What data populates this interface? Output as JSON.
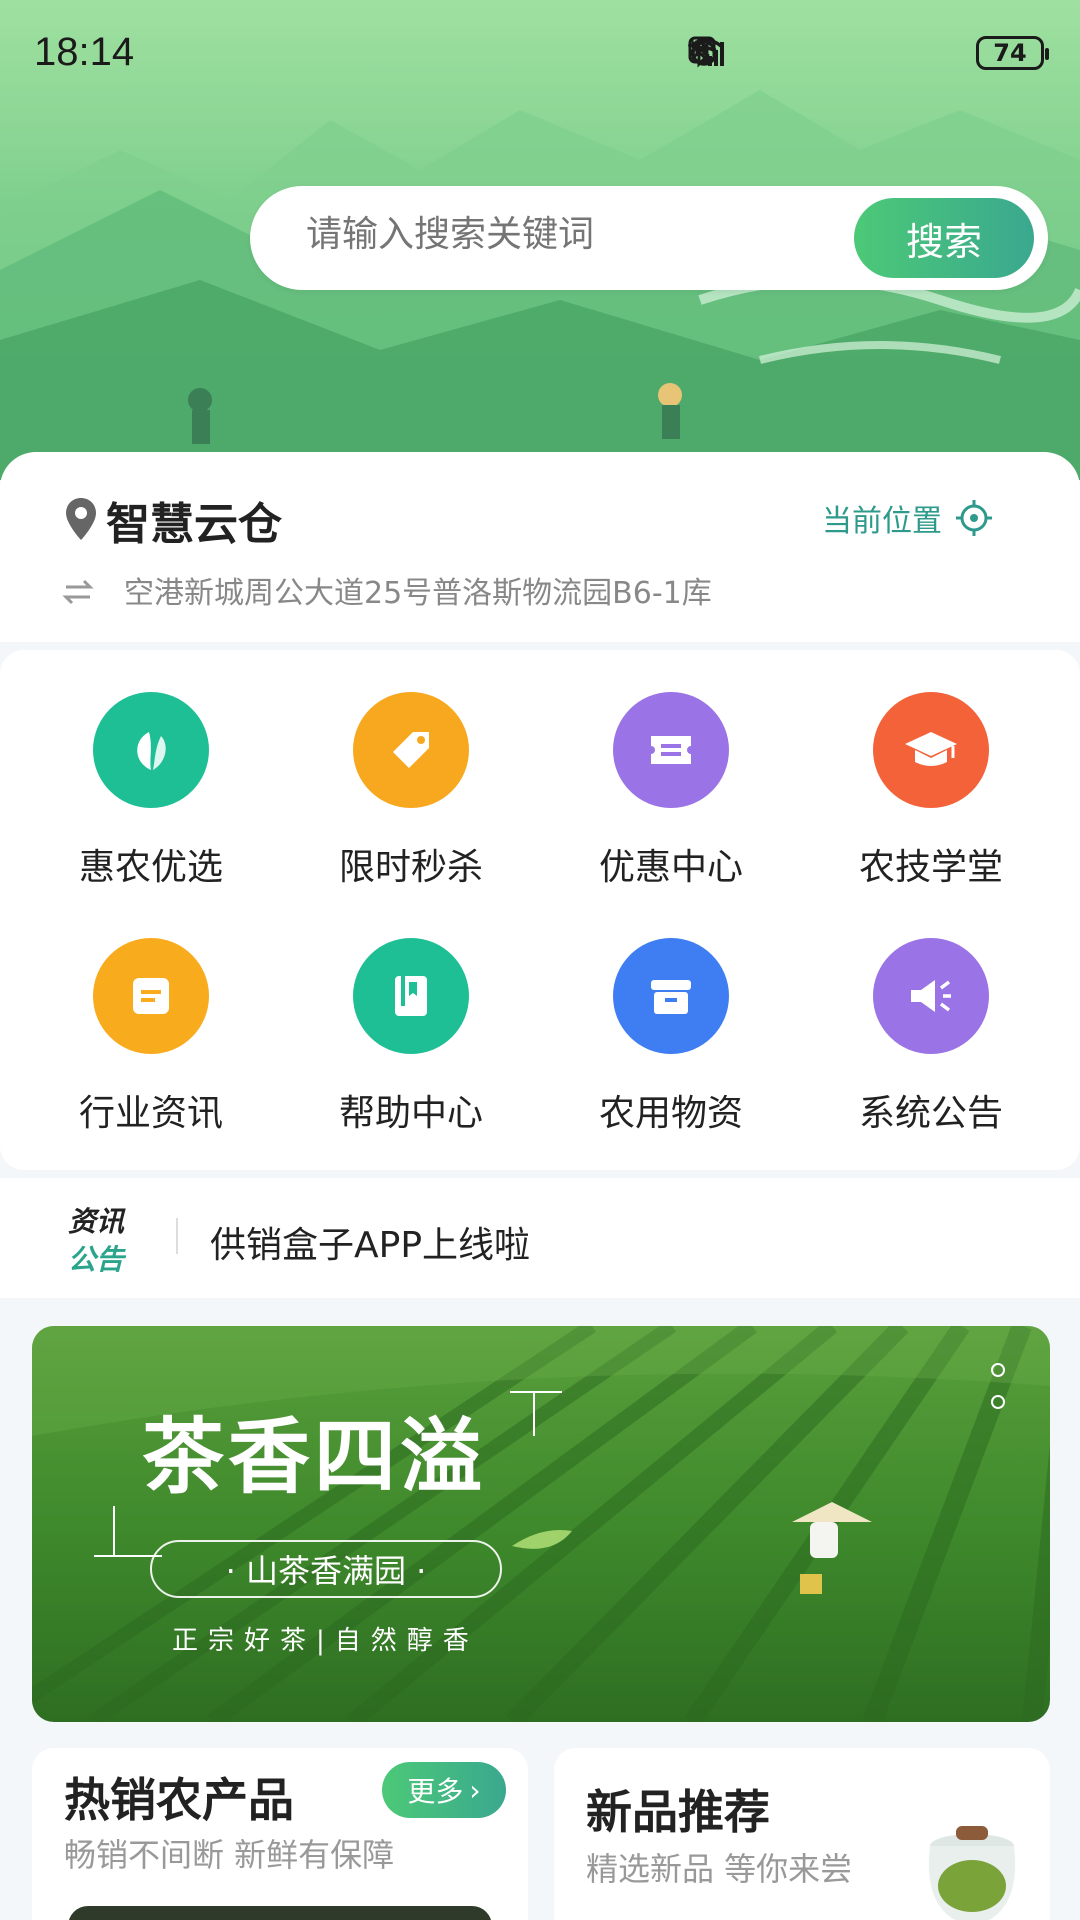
{
  "status_bar": {
    "time": "18:14",
    "icons": [
      "nfc-icon",
      "alarm-icon",
      "bluetooth-icon",
      "wifi-icon",
      "signal-4g-icon",
      "signal-4g-icon"
    ],
    "battery": "74"
  },
  "search": {
    "placeholder": "请输入搜索关键词",
    "button_label": "搜索"
  },
  "location": {
    "name": "智慧云仓",
    "current_label": "当前位置",
    "address": "空港新城周公大道25号普洛斯物流园B6-1库"
  },
  "grid": [
    {
      "label": "惠农优选",
      "icon": "leaf-icon",
      "color": "#1fbf95"
    },
    {
      "label": "限时秒杀",
      "icon": "tag-icon",
      "color": "#f8a81f"
    },
    {
      "label": "优惠中心",
      "icon": "coupon-icon",
      "color": "#9a74e6"
    },
    {
      "label": "农技学堂",
      "icon": "graduation-cap-icon",
      "color": "#f4623a"
    },
    {
      "label": "行业资讯",
      "icon": "note-icon",
      "color": "#f9ab1e"
    },
    {
      "label": "帮助中心",
      "icon": "book-icon",
      "color": "#1fbf95"
    },
    {
      "label": "农用物资",
      "icon": "box-icon",
      "color": "#3f7ef2"
    },
    {
      "label": "系统公告",
      "icon": "speaker-icon",
      "color": "#9a74e6"
    }
  ],
  "notice": {
    "tag_line1": "资讯",
    "tag_line2": "公告",
    "text": "供销盒子APP上线啦"
  },
  "banner": {
    "title": "茶香四溢",
    "pill": "· 山茶香满园 ·",
    "subtitle": "正宗好茶|自然醇香"
  },
  "cards": [
    {
      "title": "热销农产品",
      "subtitle": "畅销不间断 新鲜有保障",
      "more": "更多"
    },
    {
      "title": "新品推荐",
      "subtitle": "精选新品 等你来尝"
    }
  ]
}
